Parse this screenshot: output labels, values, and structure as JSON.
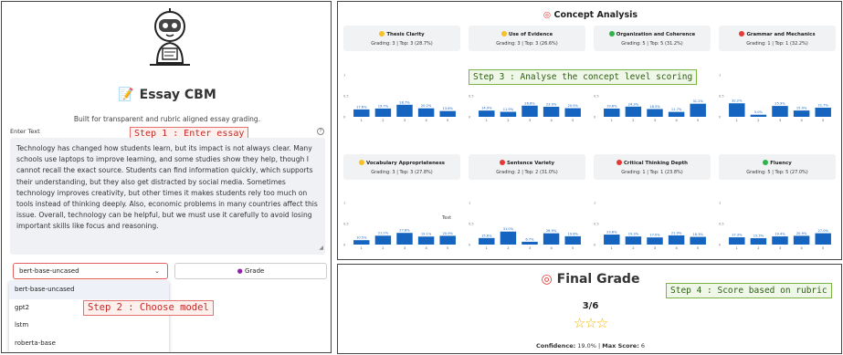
{
  "app": {
    "title": "Essay CBM",
    "subtitle": "Built for transparent and rubric aligned essay grading.",
    "field_label": "Enter Text",
    "help": "?",
    "essay": "Technology has changed how students learn, but its impact is not always clear. Many schools use laptops to improve learning, and some studies show they help, though I cannot recall the exact source. Students can find information quickly, which supports their understanding, but they also get distracted by social media. Sometimes technology improves creativity, but other times it makes students rely too much on tools instead of thinking deeply. Also, economic problems in many countries affect this issue. Overall, technology can be helpful, but we must use it carefully to avoid losing important skills like focus and reasoning.",
    "model_value": "bert-base-uncased",
    "grade_label": "Grade",
    "models": [
      "bert-base-uncased",
      "gpt2",
      "lstm",
      "roberta-base"
    ]
  },
  "steps": {
    "s1": "Step 1 : Enter essay",
    "s2": "Step 2 : Choose model",
    "s3": "Step 3 : Analyse the concept level scoring",
    "s4": "Step 4 : Score based on rubric"
  },
  "concept": {
    "title": "Concept Analysis",
    "concepts": [
      {
        "name": "Thesis Clarity",
        "status": "yellow",
        "grading": "Grading: 3  |  Top: 3 (28.7%)"
      },
      {
        "name": "Use of Evidence",
        "status": "yellow",
        "grading": "Grading: 3  |  Top: 3 (26.6%)"
      },
      {
        "name": "Organization and Coherence",
        "status": "green",
        "grading": "Grading: 5  |  Top: 5 (31.2%)"
      },
      {
        "name": "Grammar and Mechanics",
        "status": "red",
        "grading": "Grading: 1  |  Top: 1 (32.2%)"
      },
      {
        "name": "Vocabulary Appropriateness",
        "status": "yellow",
        "grading": "Grading: 3  |  Top: 3 (27.8%)"
      },
      {
        "name": "Sentence Variety",
        "status": "red",
        "grading": "Grading: 2  |  Top: 2 (31.0%)"
      },
      {
        "name": "Critical Thinking Depth",
        "status": "red",
        "grading": "Grading: 1  |  Top: 1 (23.8%)"
      },
      {
        "name": "Fluency",
        "status": "green",
        "grading": "Grading: 5  |  Top: 5 (27.0%)"
      }
    ],
    "text_annotation": "Text"
  },
  "chart_data": [
    {
      "type": "bar",
      "categories": [
        "1",
        "2",
        "3",
        "4",
        "5"
      ],
      "values": [
        17.6,
        19.7,
        28.7,
        20.2,
        13.8
      ],
      "ylim": [
        0,
        1
      ],
      "ytick_labels": [
        "0",
        "0.5",
        "1"
      ]
    },
    {
      "type": "bar",
      "categories": [
        "1",
        "2",
        "3",
        "4",
        "5"
      ],
      "values": [
        14.9,
        11.9,
        26.6,
        23.9,
        20.5
      ],
      "ylim": [
        0,
        1
      ],
      "ytick_labels": [
        "0",
        "0.5",
        "1"
      ]
    },
    {
      "type": "bar",
      "categories": [
        "1",
        "2",
        "3",
        "4",
        "5"
      ],
      "values": [
        19.6,
        24.3,
        18.5,
        11.7,
        31.2
      ],
      "ylim": [
        0,
        1
      ],
      "ytick_labels": [
        "0",
        "0.5",
        "1"
      ]
    },
    {
      "type": "bar",
      "categories": [
        "1",
        "2",
        "3",
        "4",
        "5"
      ],
      "values": [
        32.2,
        5.0,
        25.9,
        15.0,
        21.7
      ],
      "ylim": [
        0,
        1
      ],
      "ytick_labels": [
        "0",
        "0.5",
        "1"
      ]
    },
    {
      "type": "bar",
      "categories": [
        "1",
        "2",
        "3",
        "4",
        "5"
      ],
      "values": [
        10.5,
        21.2,
        27.8,
        19.1,
        20.9
      ],
      "ylim": [
        0,
        1
      ],
      "ytick_labels": [
        "0",
        "0.5",
        "1"
      ]
    },
    {
      "type": "bar",
      "categories": [
        "1",
        "2",
        "3",
        "4",
        "5"
      ],
      "values": [
        15.6,
        31.0,
        6.7,
        26.9,
        19.8
      ],
      "ylim": [
        0,
        1
      ],
      "ytick_labels": [
        "0",
        "0.5",
        "1"
      ]
    },
    {
      "type": "bar",
      "categories": [
        "1",
        "2",
        "3",
        "4",
        "5"
      ],
      "values": [
        23.8,
        19.3,
        17.0,
        21.9,
        18.3
      ],
      "ylim": [
        0,
        1
      ],
      "ytick_labels": [
        "0",
        "0.5",
        "1"
      ]
    },
    {
      "type": "bar",
      "categories": [
        "1",
        "2",
        "3",
        "4",
        "5"
      ],
      "values": [
        17.3,
        15.3,
        19.4,
        20.9,
        27.0
      ],
      "ylim": [
        0,
        1
      ],
      "ytick_labels": [
        "0",
        "0.5",
        "1"
      ]
    }
  ],
  "final": {
    "title": "Final Grade",
    "score": "3/6",
    "stars": "☆☆☆",
    "confidence_label": "Confidence:",
    "confidence_value": "19.0%",
    "max_label": "Max Score:",
    "max_value": "6"
  },
  "colors": {
    "bar": "#1565c0",
    "yellow": "#f6c026",
    "green": "#2fb34a",
    "red": "#e53935"
  }
}
